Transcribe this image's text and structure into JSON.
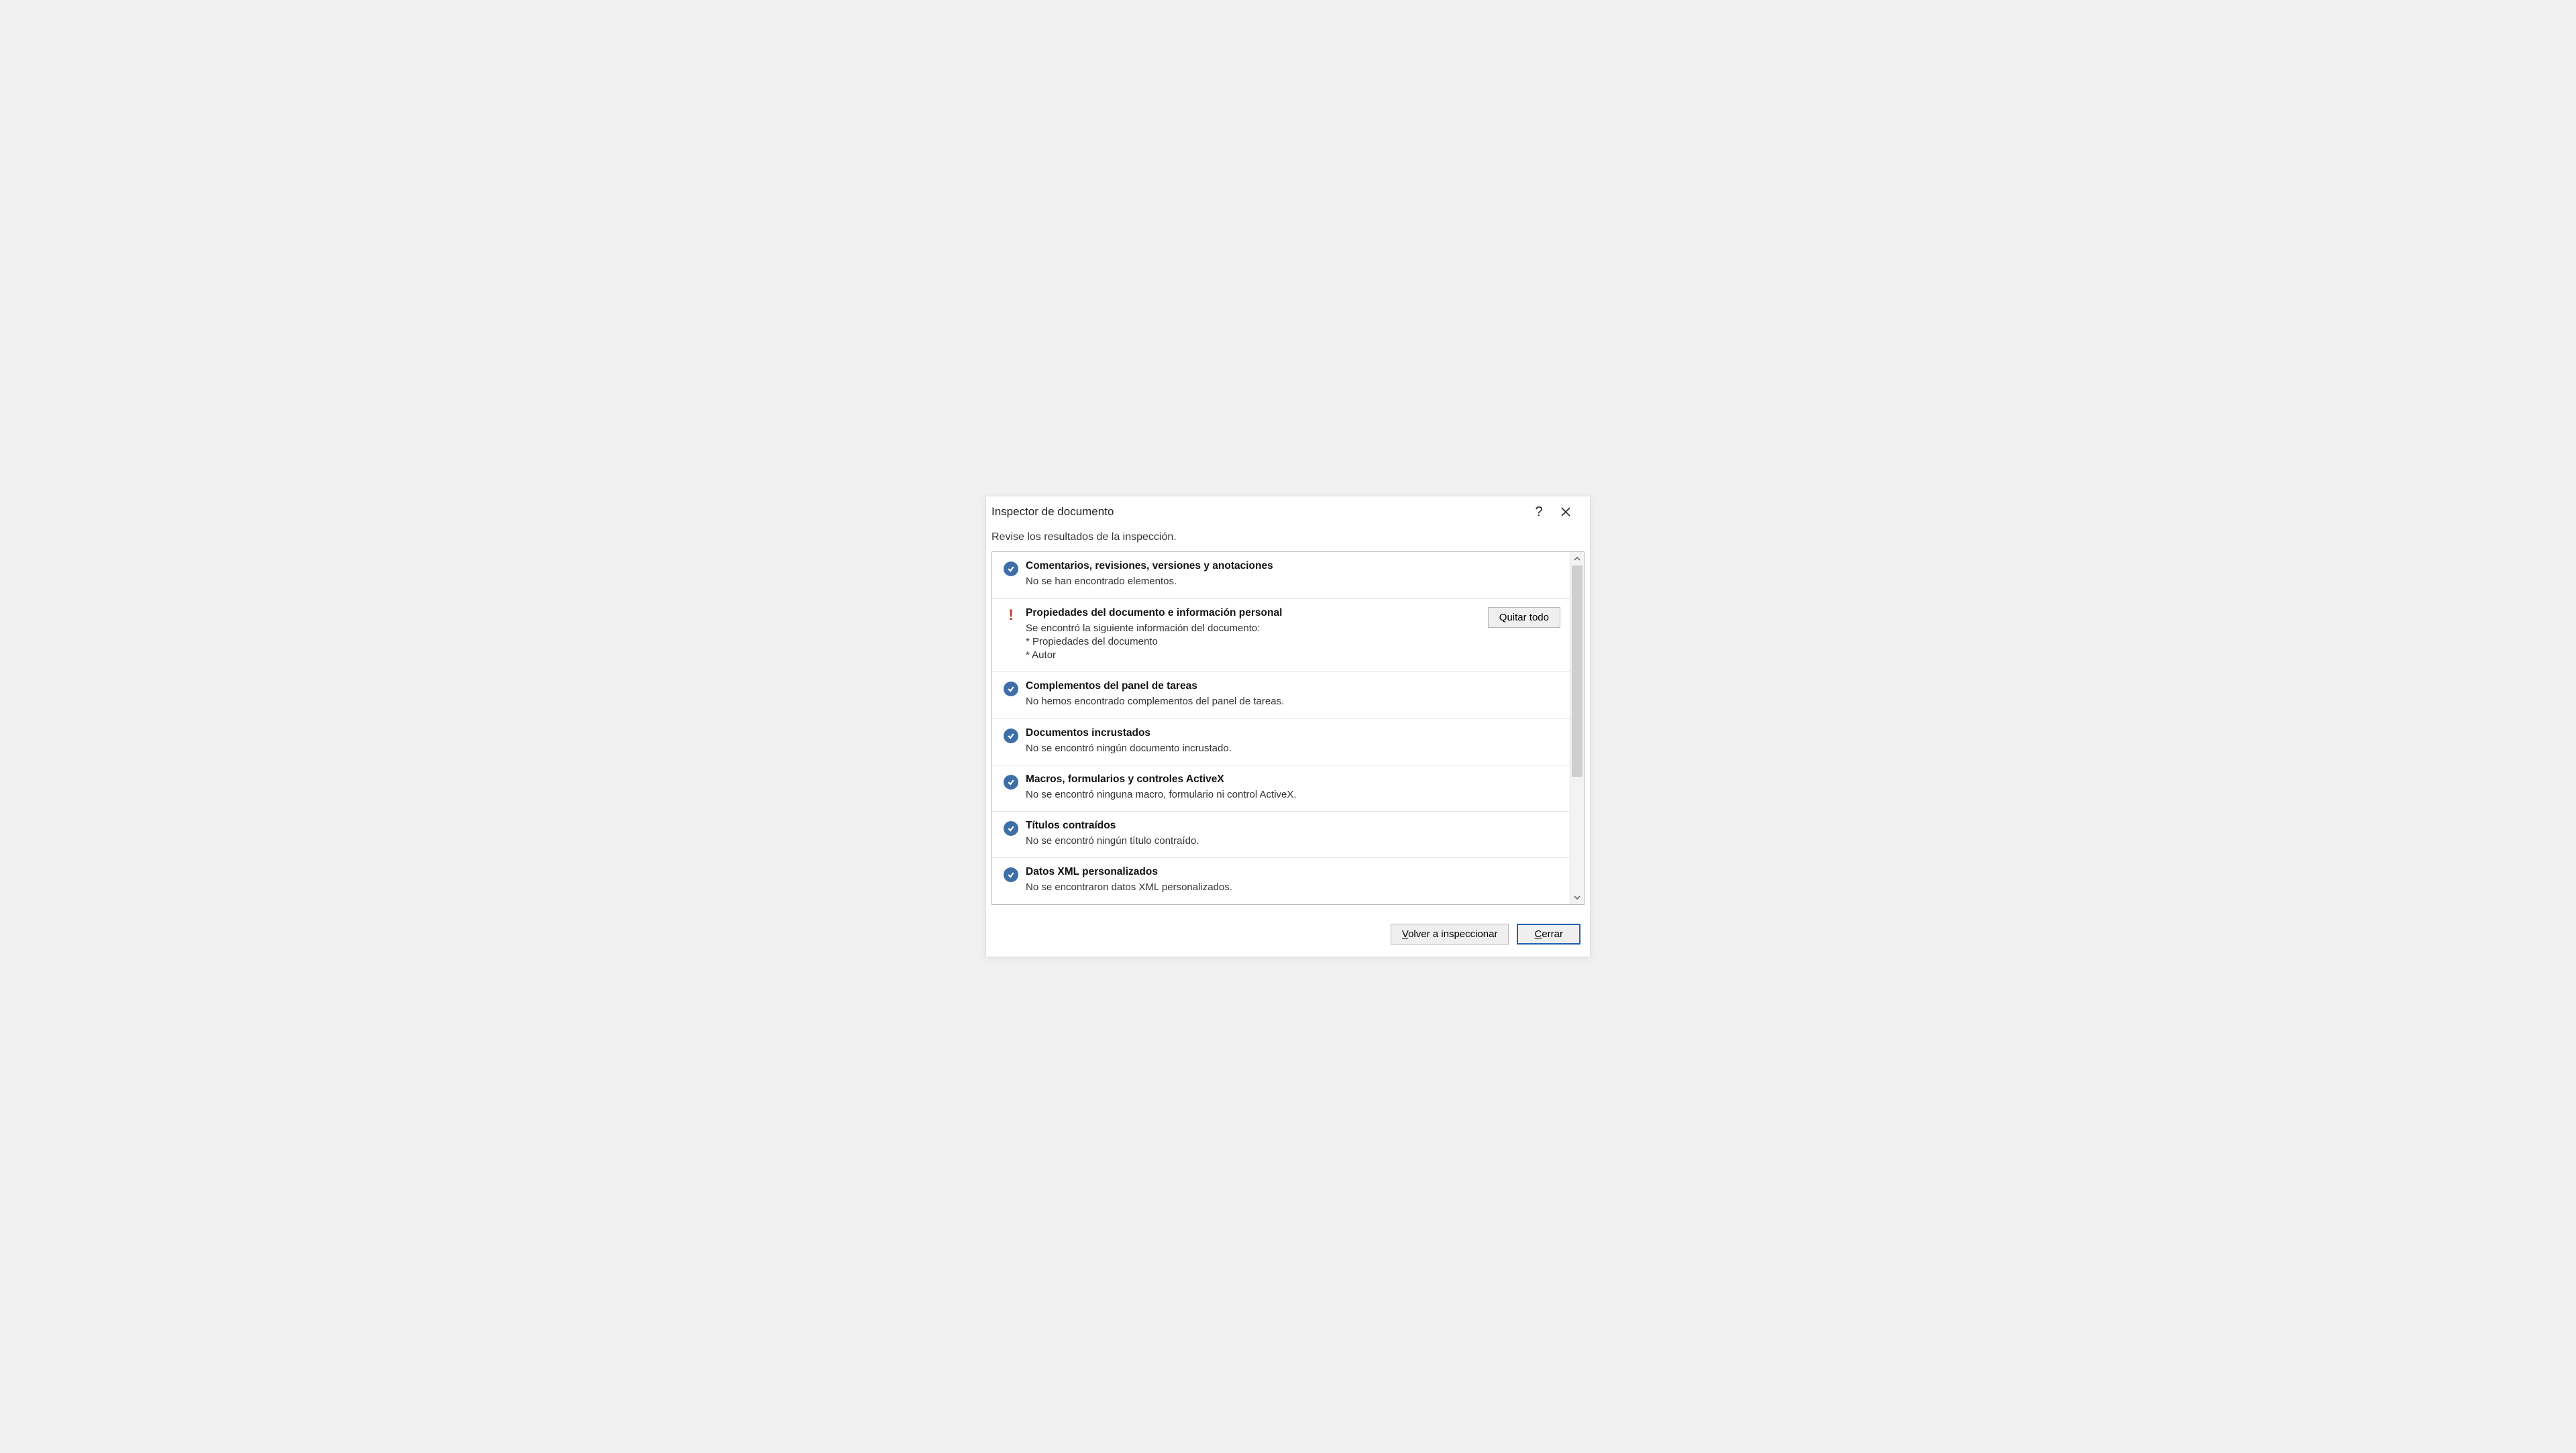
{
  "dialog": {
    "title": "Inspector de documento",
    "subtitle": "Revise los resultados de la inspección."
  },
  "results": [
    {
      "status": "ok",
      "title": "Comentarios, revisiones, versiones y anotaciones",
      "desc": "No se han encontrado elementos.",
      "action": null
    },
    {
      "status": "warn",
      "title": "Propiedades del documento e información personal",
      "desc": "Se encontró la siguiente información del documento:\n* Propiedades del documento\n* Autor",
      "action": "Quitar todo"
    },
    {
      "status": "ok",
      "title": "Complementos del panel de tareas",
      "desc": "No hemos encontrado complementos del panel de tareas.",
      "action": null
    },
    {
      "status": "ok",
      "title": "Documentos incrustados",
      "desc": "No se encontró ningún documento incrustado.",
      "action": null
    },
    {
      "status": "ok",
      "title": "Macros, formularios y controles ActiveX",
      "desc": "No se encontró ninguna macro, formulario ni control ActiveX.",
      "action": null
    },
    {
      "status": "ok",
      "title": "Títulos contraídos",
      "desc": "No se encontró ningún título contraído.",
      "action": null
    },
    {
      "status": "ok",
      "title": "Datos XML personalizados",
      "desc": "No se encontraron datos XML personalizados.",
      "action": null
    }
  ],
  "footer": {
    "reinspect": "Volver a inspeccionar",
    "reinspect_mnemonic": "V",
    "close": "Cerrar",
    "close_mnemonic": "C"
  }
}
